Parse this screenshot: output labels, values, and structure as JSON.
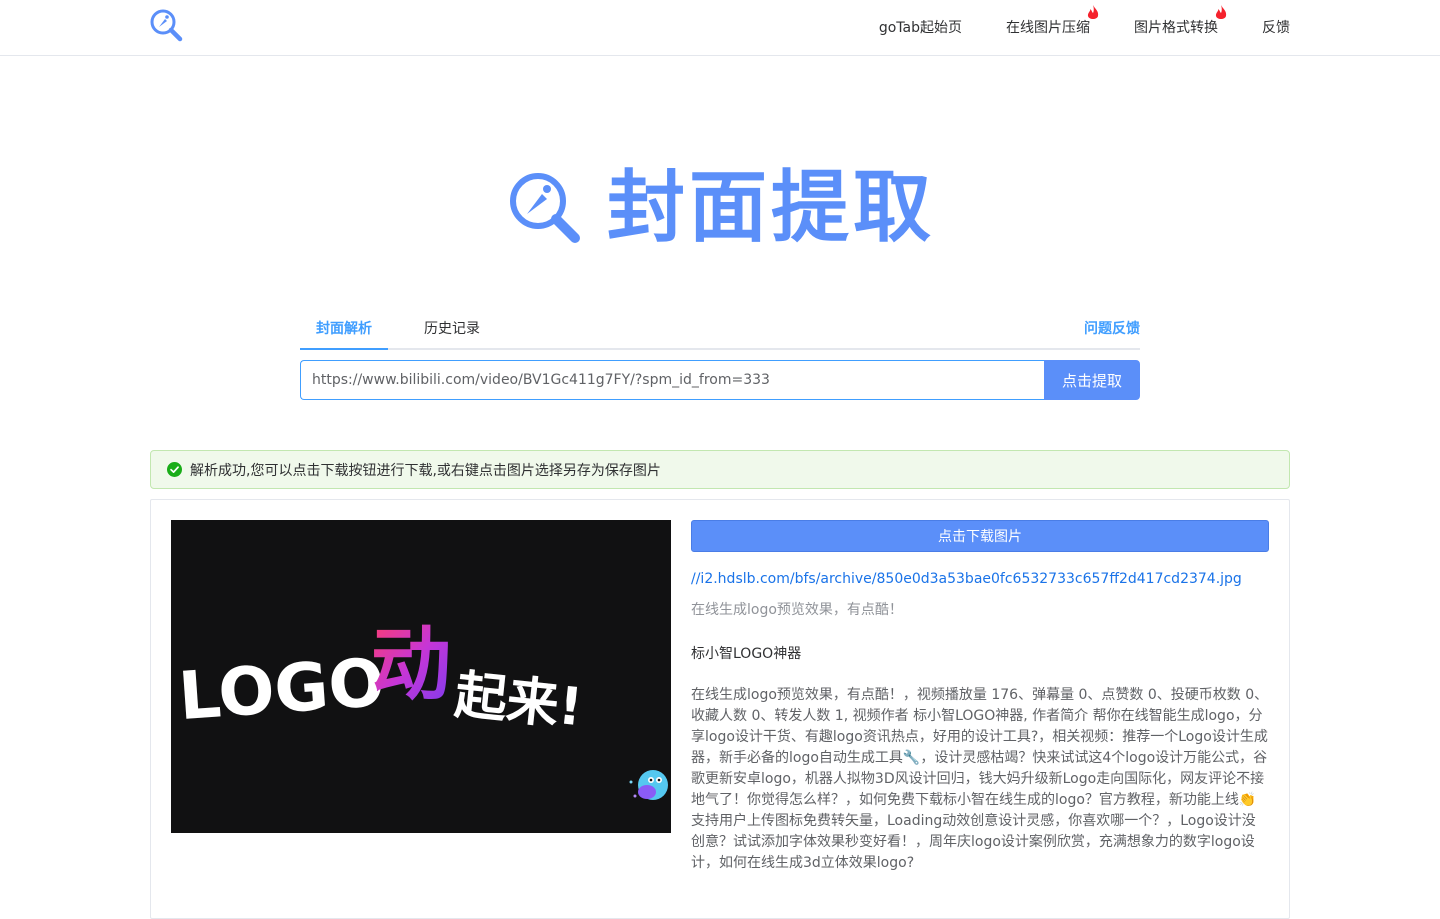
{
  "nav": {
    "items": [
      {
        "label": "goTab起始页",
        "hot": false
      },
      {
        "label": "在线图片压缩",
        "hot": true
      },
      {
        "label": "图片格式转换",
        "hot": true
      },
      {
        "label": "反馈",
        "hot": false
      }
    ]
  },
  "hero": {
    "title": "封面提取"
  },
  "tabs": {
    "parse": "封面解析",
    "history": "历史记录",
    "feedback": "问题反馈"
  },
  "search": {
    "value": "https://www.bilibili.com/video/BV1Gc411g7FY/?spm_id_from=333",
    "button": "点击提取"
  },
  "alert": {
    "message": "解析成功,您可以点击下载按钮进行下载,或右键点击图片选择另存为保存图片"
  },
  "result": {
    "cover_text_logo": "LOGO",
    "cover_text_dong": "动",
    "cover_text_rest": "起来!",
    "download_button": "点击下载图片",
    "image_url": "//i2.hdslb.com/bfs/archive/850e0d3a53bae0fc6532733c657ff2d417cd2374.jpg",
    "title": "在线生成logo预览效果，有点酷！",
    "uploader": "标小智LOGO神器",
    "description": "在线生成logo预览效果，有点酷！，视频播放量 176、弹幕量 0、点赞数 0、投硬币枚数 0、收藏人数 0、转发人数 1, 视频作者 标小智LOGO神器, 作者简介 帮你在线智能生成logo，分享logo设计干货、有趣logo资讯热点，好用的设计工具?，相关视频：推荐一个Logo设计生成器，新手必备的logo自动生成工具🔧，设计灵感枯竭？快来试试这4个logo设计万能公式，谷歌更新安卓logo，机器人拟物3D风设计回归，钱大妈升级新Logo走向国际化，网友评论不接地气了！你觉得怎么样？，如何免费下载标小智在线生成的logo？官方教程，新功能上线👏支持用户上传图标免费转矢量，Loading动效创意设计灵感，你喜欢哪一个？，Logo设计没创意？试试添加字体效果秒变好看！，周年庆logo设计案例欣赏，充满想象力的数字logo设计，如何在线生成3d立体效果logo?"
  },
  "colors": {
    "accent": "#409eff",
    "brand": "#5b8ff9",
    "success_bg": "#f0f9eb",
    "success": "#67c23a"
  },
  "icons": {
    "logo": "magnifier-logo-icon",
    "hot": "fire-icon",
    "success": "check-circle-icon"
  }
}
